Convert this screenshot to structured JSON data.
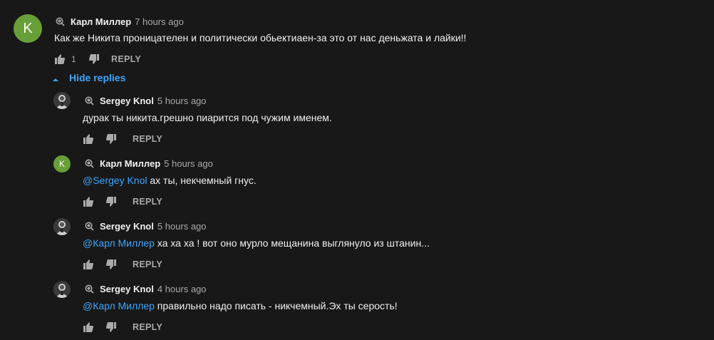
{
  "colors": {
    "background": "#181818",
    "text": "#f1f1f1",
    "secondary_text": "#aaaaaa",
    "link": "#3ea6ff",
    "avatar_green": "#689f38"
  },
  "top_comment": {
    "avatar_letter": "K",
    "author": "Карл Миллер",
    "time": "7 hours ago",
    "text": "Как же Никита проницателен и политически обьектиаен-за это от нас деньжата и лайки!!",
    "like_count": "1",
    "reply_label": "REPLY",
    "icons": [
      "search-icon",
      "thumbs-up-icon",
      "thumbs-down-icon"
    ]
  },
  "hide_replies": {
    "label": "Hide replies",
    "icon": "caret-up-icon"
  },
  "replies": [
    {
      "author": "Sergey Knol",
      "time": "5 hours ago",
      "mention": "",
      "text": "дурак ты никита.грешно пиарится под чужим именем.",
      "reply_label": "REPLY",
      "avatar": "photo"
    },
    {
      "author": "Карл Миллер",
      "time": "5 hours ago",
      "mention": "@Sergey Knol",
      "text": " ах ты, некчемный гнус.",
      "reply_label": "REPLY",
      "avatar": "letter",
      "avatar_letter": "K"
    },
    {
      "author": "Sergey Knol",
      "time": "5 hours ago",
      "mention": "@Карл Миллер",
      "text": " ха ха ха !  вот оно мурло мещанина выглянуло из штанин...",
      "reply_label": "REPLY",
      "avatar": "photo"
    },
    {
      "author": "Sergey Knol",
      "time": "4 hours ago",
      "mention": "@Карл Миллер",
      "text": " правильно надо писать - никчемный.Эх ты серость!",
      "reply_label": "REPLY",
      "avatar": "photo"
    }
  ]
}
